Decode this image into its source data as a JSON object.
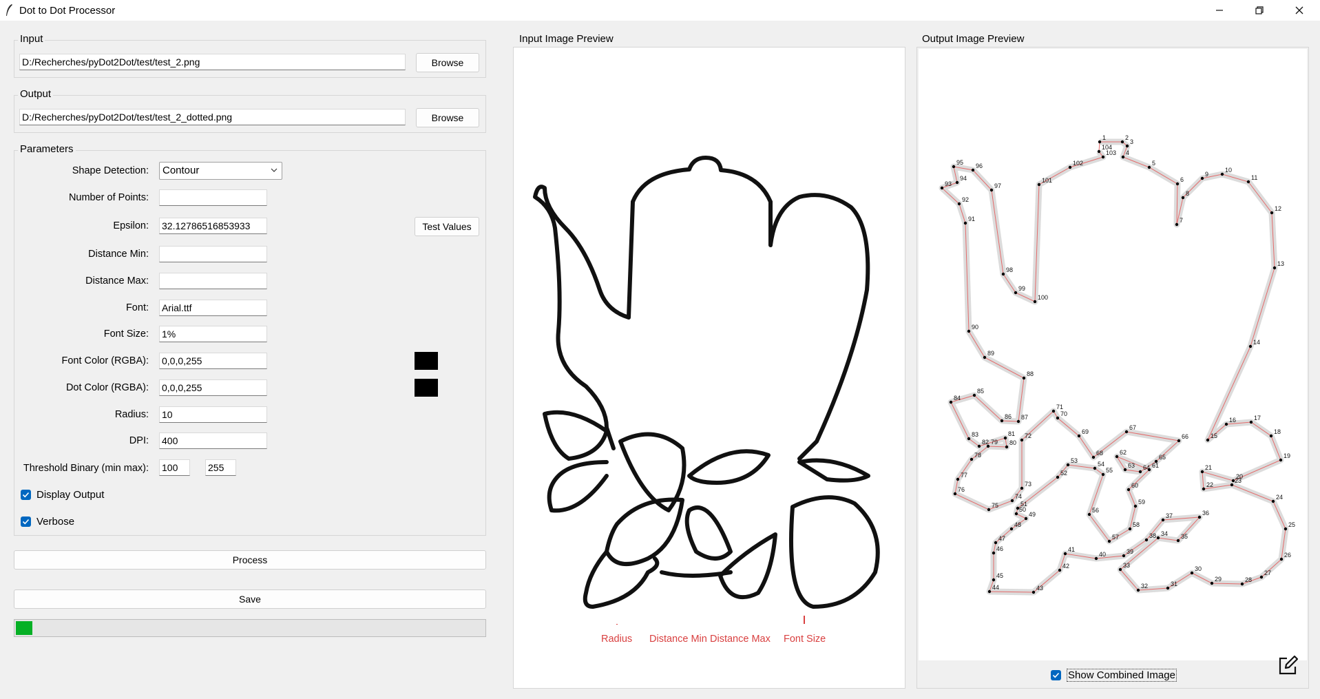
{
  "window": {
    "title": "Dot to Dot Processor"
  },
  "input": {
    "group_label": "Input",
    "path": "D:/Recherches/pyDot2Dot/test/test_2.png",
    "browse_label": "Browse"
  },
  "output": {
    "group_label": "Output",
    "path": "D:/Recherches/pyDot2Dot/test/test_2_dotted.png",
    "browse_label": "Browse"
  },
  "params": {
    "group_label": "Parameters",
    "shape_detection": {
      "label": "Shape Detection:",
      "value": "Contour"
    },
    "num_points": {
      "label": "Number of Points:",
      "value": ""
    },
    "epsilon": {
      "label": "Epsilon:",
      "value": "32.12786516853933"
    },
    "test_values_label": "Test Values",
    "distance_min": {
      "label": "Distance Min:",
      "value": ""
    },
    "distance_max": {
      "label": "Distance Max:",
      "value": ""
    },
    "font": {
      "label": "Font:",
      "value": "Arial.ttf"
    },
    "font_size": {
      "label": "Font Size:",
      "value": "1%"
    },
    "font_color": {
      "label": "Font Color (RGBA):",
      "value": "0,0,0,255",
      "swatch": "#000000"
    },
    "dot_color": {
      "label": "Dot Color (RGBA):",
      "value": "0,0,0,255",
      "swatch": "#000000"
    },
    "radius": {
      "label": "Radius:",
      "value": "10"
    },
    "dpi": {
      "label": "DPI:",
      "value": "400"
    },
    "threshold": {
      "label": "Threshold Binary (min max):",
      "min": "100",
      "max": "255"
    },
    "display_output": {
      "label": "Display Output",
      "checked": true
    },
    "verbose": {
      "label": "Verbose",
      "checked": true
    }
  },
  "actions": {
    "process_label": "Process",
    "save_label": "Save",
    "progress_fraction": 0.035,
    "progress_color": "#06b025"
  },
  "input_preview": {
    "group_label": "Input Image Preview",
    "overlay": {
      "radius": "Radius",
      "distance_min": "Distance Min",
      "distance_max": "Distance Max",
      "font_size": "Font Size"
    }
  },
  "output_preview": {
    "group_label": "Output Image Preview",
    "show_combined": {
      "label": "Show Combined Image",
      "checked": true
    },
    "dots": [
      [
        "1",
        1596,
        205
      ],
      [
        "2",
        1629,
        205
      ],
      [
        "3",
        1636,
        211
      ],
      [
        "4",
        1630,
        227
      ],
      [
        "5",
        1668,
        242
      ],
      [
        "6",
        1709,
        266
      ],
      [
        "7",
        1708,
        325
      ],
      [
        "8",
        1717,
        286
      ],
      [
        "9",
        1745,
        258
      ],
      [
        "10",
        1774,
        252
      ],
      [
        "11",
        1812,
        263
      ],
      [
        "12",
        1846,
        308
      ],
      [
        "13",
        1850,
        388
      ],
      [
        "14",
        1815,
        502
      ],
      [
        "15",
        1753,
        638
      ],
      [
        "16",
        1780,
        615
      ],
      [
        "17",
        1816,
        612
      ],
      [
        "18",
        1845,
        632
      ],
      [
        "19",
        1859,
        667
      ],
      [
        "20",
        1790,
        697
      ],
      [
        "21",
        1745,
        684
      ],
      [
        "22",
        1747,
        709
      ],
      [
        "23",
        1788,
        703
      ],
      [
        "24",
        1848,
        727
      ],
      [
        "25",
        1866,
        767
      ],
      [
        "26",
        1860,
        811
      ],
      [
        "27",
        1831,
        837
      ],
      [
        "28",
        1803,
        847
      ],
      [
        "29",
        1759,
        846
      ],
      [
        "30",
        1730,
        831
      ],
      [
        "31",
        1695,
        853
      ],
      [
        "32",
        1652,
        856
      ],
      [
        "33",
        1626,
        826
      ],
      [
        "34",
        1681,
        780
      ],
      [
        "35",
        1710,
        784
      ],
      [
        "36",
        1741,
        750
      ],
      [
        "37",
        1688,
        754
      ],
      [
        "38",
        1664,
        783
      ],
      [
        "39",
        1631,
        806
      ],
      [
        "40",
        1591,
        810
      ],
      [
        "41",
        1546,
        803
      ],
      [
        "42",
        1538,
        827
      ],
      [
        "43",
        1500,
        859
      ],
      [
        "44",
        1436,
        858
      ],
      [
        "45",
        1442,
        841
      ],
      [
        "46",
        1442,
        802
      ],
      [
        "47",
        1445,
        787
      ],
      [
        "48",
        1468,
        767
      ],
      [
        "49",
        1489,
        752
      ],
      [
        "50",
        1475,
        745
      ],
      [
        "51",
        1477,
        737
      ],
      [
        "52",
        1535,
        692
      ],
      [
        "53",
        1550,
        674
      ],
      [
        "54",
        1589,
        679
      ],
      [
        "55",
        1601,
        688
      ],
      [
        "56",
        1581,
        746
      ],
      [
        "57",
        1610,
        785
      ],
      [
        "58",
        1640,
        767
      ],
      [
        "59",
        1648,
        734
      ],
      [
        "60",
        1638,
        710
      ],
      [
        "61",
        1668,
        681
      ],
      [
        "62",
        1621,
        662
      ],
      [
        "63",
        1633,
        681
      ],
      [
        "64",
        1655,
        684
      ],
      [
        "65",
        1678,
        669
      ],
      [
        "66",
        1711,
        639
      ],
      [
        "67",
        1635,
        626
      ],
      [
        "68",
        1587,
        663
      ],
      [
        "69",
        1566,
        632
      ],
      [
        "70",
        1535,
        606
      ],
      [
        "71",
        1529,
        596
      ],
      [
        "72",
        1483,
        638
      ],
      [
        "73",
        1483,
        708
      ],
      [
        "74",
        1469,
        726
      ],
      [
        "75",
        1435,
        739
      ],
      [
        "76",
        1386,
        716
      ],
      [
        "77",
        1390,
        695
      ],
      [
        "78",
        1410,
        666
      ],
      [
        "79",
        1434,
        647
      ],
      [
        "80",
        1461,
        648
      ],
      [
        "81",
        1459,
        635
      ],
      [
        "82",
        1421,
        647
      ],
      [
        "83",
        1406,
        636
      ],
      [
        "84",
        1380,
        583
      ],
      [
        "85",
        1414,
        573
      ],
      [
        "86",
        1454,
        610
      ],
      [
        "87",
        1478,
        611
      ],
      [
        "88",
        1486,
        548
      ],
      [
        "89",
        1429,
        518
      ],
      [
        "90",
        1406,
        480
      ],
      [
        "91",
        1401,
        323
      ],
      [
        "92",
        1392,
        295
      ],
      [
        "93",
        1367,
        272
      ],
      [
        "94",
        1389,
        264
      ],
      [
        "95",
        1384,
        241
      ],
      [
        "96",
        1412,
        246
      ],
      [
        "97",
        1439,
        275
      ],
      [
        "98",
        1456,
        397
      ],
      [
        "99",
        1474,
        424
      ],
      [
        "100",
        1502,
        437
      ],
      [
        "101",
        1508,
        267
      ],
      [
        "102",
        1553,
        242
      ],
      [
        "103",
        1601,
        227
      ],
      [
        "104",
        1595,
        219
      ]
    ]
  }
}
